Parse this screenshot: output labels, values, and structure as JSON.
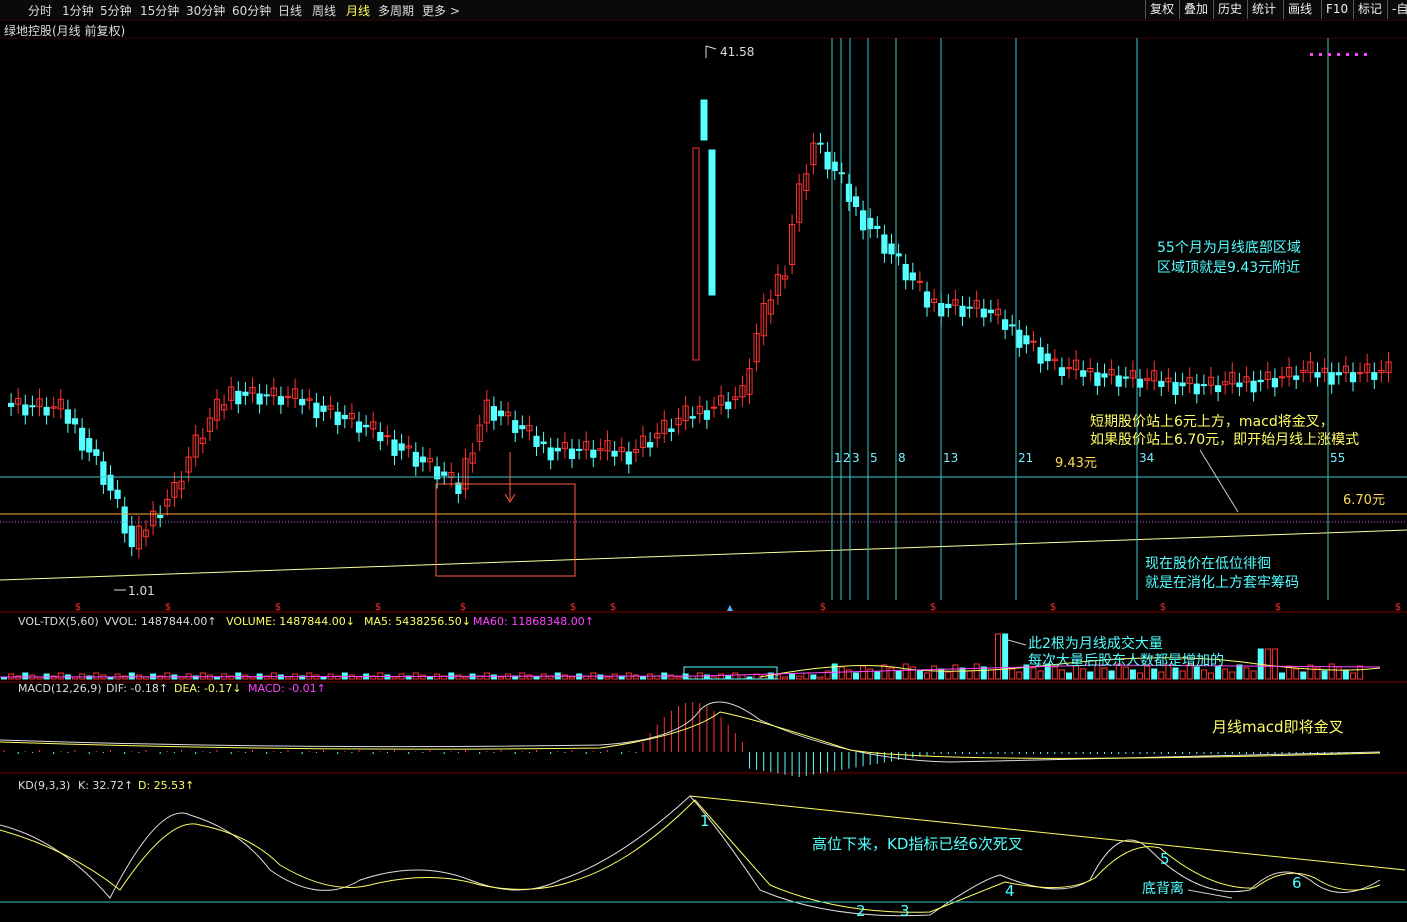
{
  "toolbar": {
    "periods": [
      "分时",
      "1分钟",
      "5分钟",
      "15分钟",
      "30分钟",
      "60分钟",
      "日线",
      "周线",
      "月线",
      "多周期",
      "更多 >"
    ],
    "active": "月线",
    "right_buttons": [
      "复权",
      "叠加",
      "历史",
      "统计",
      "画线",
      "F10",
      "标记",
      "-自"
    ]
  },
  "stock_title": "绿地控股(月线 前复权)",
  "indicators": {
    "vol": {
      "label": "VOL-TDX(5,60)",
      "vvol": "VVOL: 1487844.00",
      "volume": "VOLUME: 1487844.00",
      "ma5": "MA5: 5438256.50",
      "ma60": "MA60: 11868348.00"
    },
    "macd": {
      "label": "MACD(12,26,9)",
      "dif": "DIF: -0.18",
      "dea": "DEA: -0.17",
      "macd": "MACD: -0.01"
    },
    "kd": {
      "label": "KD(9,3,3)",
      "k": "K: 32.72",
      "d": "D: 25.53"
    }
  },
  "price_labels": {
    "high": "41.58",
    "low": "1.01",
    "level_943": "9.43元",
    "level_670": "6.70元"
  },
  "vline_labels": [
    "1",
    "2",
    "3",
    "5",
    "8",
    "13",
    "21",
    "34",
    "55"
  ],
  "annotations": {
    "a1_l1": "55个月为月线底部区域",
    "a1_l2": "区域顶就是9.43元附近",
    "a2_l1": "短期股价站上6元上方，macd将金叉，",
    "a2_l2": "如果股价站上6.70元，即开始月线上涨模式",
    "a3_l1": "现在股价在低位徘徊",
    "a3_l2": "就是在消化上方套牢筹码",
    "a4_l1": "此2根为月线成交大量",
    "a4_l2": "每次大量后股东人数都是增加的",
    "a5": "月线macd即将金叉",
    "a6": "高位下来，KD指标已经6次死叉",
    "a7": "底背离",
    "kd_nums": [
      "1",
      "2",
      "3",
      "4",
      "5",
      "6"
    ]
  },
  "colors": {
    "up": "#ff3232",
    "down": "#54ffff",
    "ma": "#ffff99",
    "cyan_line": "#3ec8c8",
    "macd_dea": "#ffff66",
    "kd_d": "#ffff66"
  },
  "chart_data": {
    "type": "candlestick",
    "y_scale": "log",
    "price_high": 41.58,
    "price_low": 1.01,
    "levels": [
      9.43,
      6.7
    ]
  }
}
